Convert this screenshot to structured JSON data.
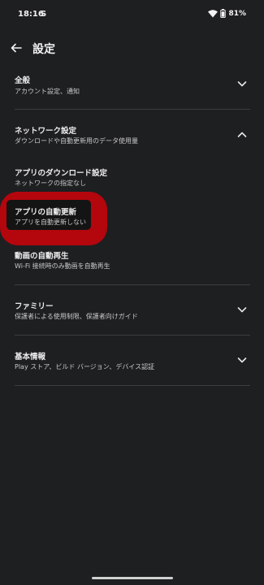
{
  "status": {
    "time": "18:16",
    "app_icon": "S",
    "battery": "81%",
    "icons": [
      "wifi-icon",
      "battery-icon"
    ]
  },
  "app_bar": {
    "title": "設定",
    "back_icon": "arrow-left-icon"
  },
  "items": {
    "general": {
      "title": "全般",
      "subtitle": "アカウント設定、通知",
      "expanded": false
    },
    "network": {
      "title": "ネットワーク設定",
      "subtitle": "ダウンロードや自動更新用のデータ使用量",
      "expanded": true
    },
    "app_download": {
      "title": "アプリのダウンロード設定",
      "subtitle": "ネットワークの指定なし"
    },
    "auto_update": {
      "title": "アプリの自動更新",
      "subtitle": "アプリを自動更新しない"
    },
    "video_autoplay": {
      "title": "動画の自動再生",
      "subtitle": "Wi-Fi 接続時のみ動画を自動再生"
    },
    "family": {
      "title": "ファミリー",
      "subtitle": "保護者による使用制限、保護者向けガイド",
      "expanded": false
    },
    "about": {
      "title": "基本情報",
      "subtitle": "Play ストア、ビルド バージョン、デバイス認証",
      "expanded": false
    }
  },
  "colors": {
    "background": "#1e1f21",
    "highlight": "#b3060d",
    "divider": "#3c3d40"
  }
}
